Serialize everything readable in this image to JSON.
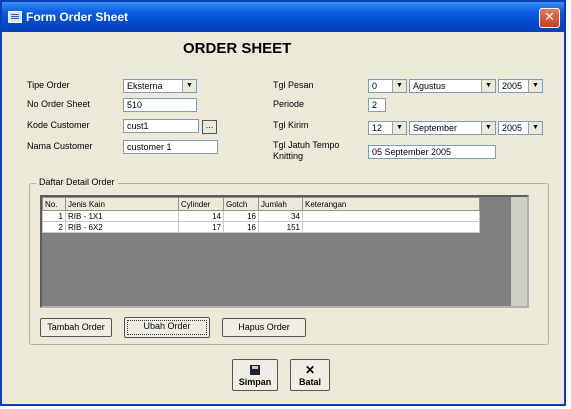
{
  "window": {
    "title": "Form Order Sheet",
    "close_glyph": "✕",
    "title_icon": "form-icon"
  },
  "heading": "ORDER SHEET",
  "form": {
    "tipe_order": {
      "label": "Tipe Order",
      "value": "Eksterna"
    },
    "no_order_sheet": {
      "label": "No Order Sheet",
      "value": "510"
    },
    "kode_customer": {
      "label": "Kode Customer",
      "value": "cust1",
      "browse_label": "..."
    },
    "nama_customer": {
      "label": "Nama Customer",
      "value": "customer 1"
    },
    "tgl_pesan": {
      "label": "Tgl Pesan",
      "day": "0",
      "month": "Agustus",
      "year": "2005"
    },
    "periode": {
      "label": "Periode",
      "value": "2"
    },
    "tgl_kirim": {
      "label": "Tgl Kirim",
      "day": "12",
      "month": "September",
      "year": "2005"
    },
    "tgl_jatuh_tempo": {
      "label_line1": "Tgl Jatuh Tempo",
      "label_line2": "Knitting",
      "value": "05 September 2005"
    }
  },
  "detail": {
    "group_label": "Daftar Detail Order",
    "columns": [
      "No.",
      "Jenis Kain",
      "Cylinder",
      "Gotch",
      "Jumlah",
      "Keterangan"
    ],
    "rows": [
      [
        "1",
        "RIB - 1X1",
        "14",
        "16",
        "34",
        ""
      ],
      [
        "2",
        "RIB - 6X2",
        "17",
        "16",
        "151",
        ""
      ]
    ]
  },
  "buttons": {
    "tambah": "Tambah Order",
    "ubah": "Ubah Order",
    "hapus": "Hapus Order",
    "simpan": "Simpan",
    "batal": "Batal"
  },
  "colors": {
    "title_bar": "#0a5ce0",
    "window_bg": "#ece9d8",
    "grid_bg": "#808080",
    "close": "#c8401e"
  }
}
